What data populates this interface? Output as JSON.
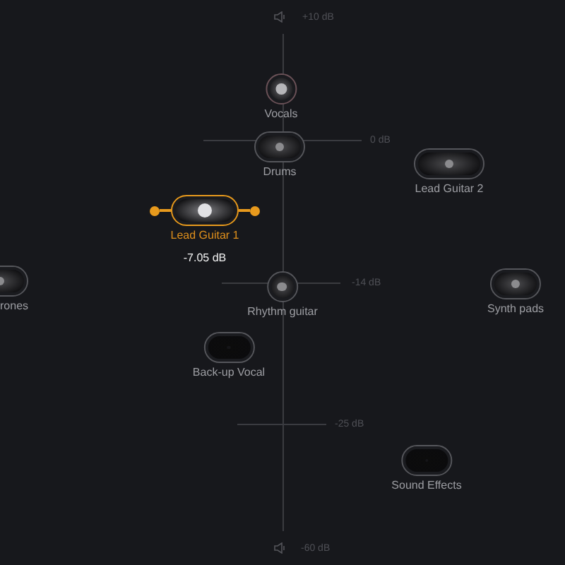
{
  "scale": {
    "top": "+10 dB",
    "bottom": "-60 dB",
    "marks": [
      "0 dB",
      "-14 dB",
      "-25 dB"
    ]
  },
  "tracks": [
    {
      "name": "Vocals",
      "selected": false
    },
    {
      "name": "Drums",
      "selected": false
    },
    {
      "name": "Lead Guitar 2",
      "selected": false
    },
    {
      "name": "Lead Guitar 1",
      "selected": true,
      "reading": "-7.05 dB"
    },
    {
      "name": "rones",
      "selected": false
    },
    {
      "name": "Rhythm guitar",
      "selected": false
    },
    {
      "name": "Synth pads",
      "selected": false
    },
    {
      "name": "Back-up Vocal",
      "selected": false
    },
    {
      "name": "Sound Effects",
      "selected": false
    }
  ]
}
